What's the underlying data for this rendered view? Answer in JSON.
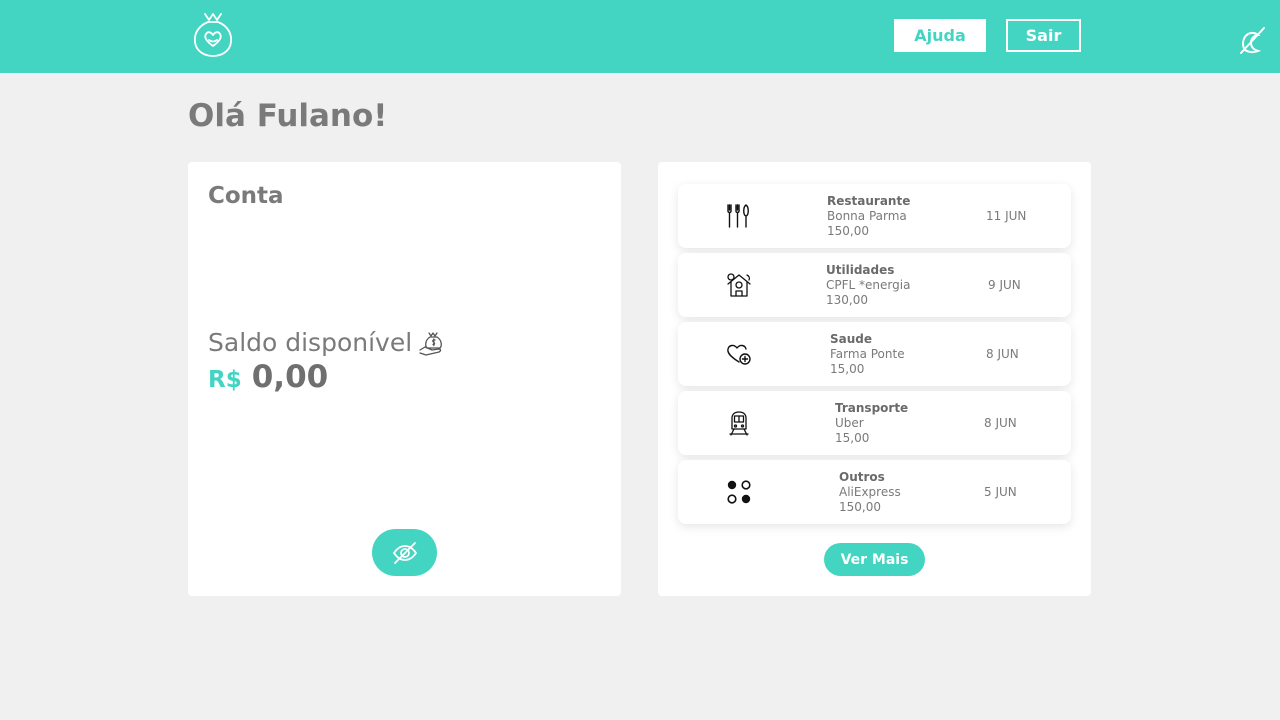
{
  "header": {
    "help_label": "Ajuda",
    "exit_label": "Sair",
    "brand_color": "#43d5c2"
  },
  "greeting": "Olá Fulano!",
  "account": {
    "title": "Conta",
    "balance_label": "Saldo disponível",
    "currency": "R$",
    "balance": "0,00"
  },
  "transactions": [
    {
      "category": "Restaurante",
      "merchant": "Bonna Parma",
      "amount": "150,00",
      "date": "11 JUN",
      "icon": "cutlery-icon"
    },
    {
      "category": "Utilidades",
      "merchant": "CPFL *energia",
      "amount": "130,00",
      "date": "9 JUN",
      "icon": "house-money-icon"
    },
    {
      "category": "Saude",
      "merchant": "Farma Ponte",
      "amount": "15,00",
      "date": "8 JUN",
      "icon": "heart-plus-icon"
    },
    {
      "category": "Transporte",
      "merchant": "Uber",
      "amount": "15,00",
      "date": "8 JUN",
      "icon": "train-icon"
    },
    {
      "category": "Outros",
      "merchant": "AliExpress",
      "amount": "150,00",
      "date": "5 JUN",
      "icon": "dots-icon"
    }
  ],
  "more_label": "Ver Mais"
}
